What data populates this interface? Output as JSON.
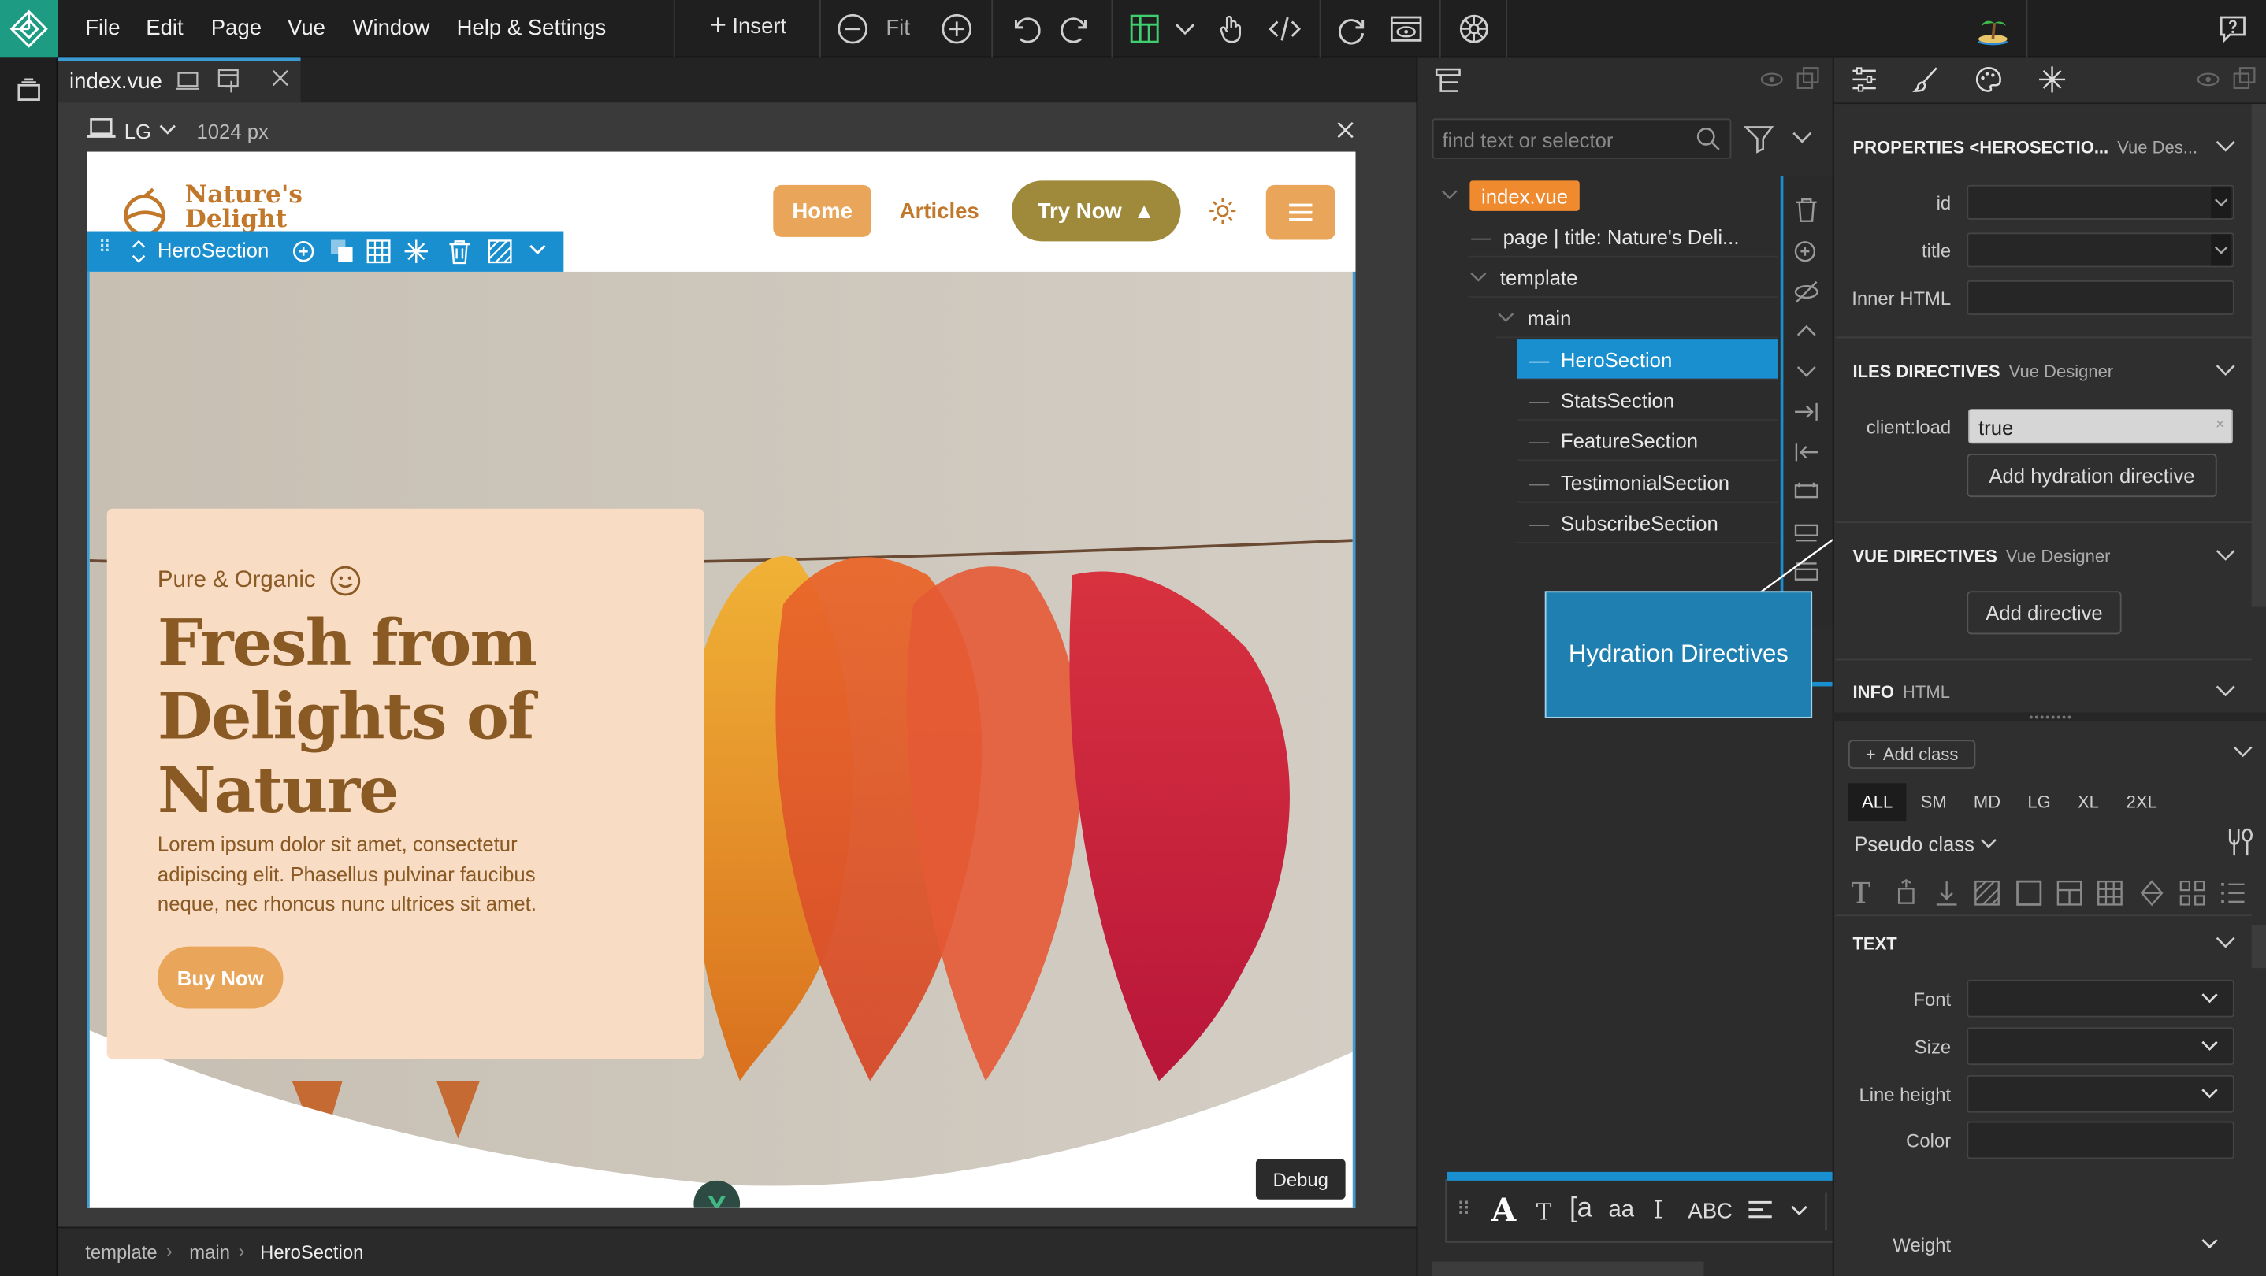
{
  "menu": [
    "File",
    "Edit",
    "Page",
    "Vue",
    "Window",
    "Help & Settings"
  ],
  "toolbar": {
    "insert": "Insert",
    "fit": "Fit"
  },
  "tab": {
    "name": "index.vue"
  },
  "device": {
    "size": "LG",
    "width": "1024 px"
  },
  "site": {
    "brand_line1": "Nature's",
    "brand_line2": "Delight",
    "nav": {
      "home": "Home",
      "articles": "Articles",
      "try": "Try Now"
    },
    "eyebrow": "Pure & Organic",
    "title_line1": "Fresh from",
    "title_line2": "Delights of",
    "title_line3": "Nature",
    "body": "Lorem ipsum dolor sit amet, consectetur adipiscing elit. Phasellus pulvinar faucibus neque, nec rhoncus nunc ultrices sit amet.",
    "cta": "Buy Now",
    "debug": "Debug"
  },
  "selection": {
    "label": "HeroSection"
  },
  "breadcrumb": [
    "template",
    "main",
    "HeroSection"
  ],
  "tree": {
    "search_placeholder": "find text or selector",
    "root": "index.vue",
    "items": [
      {
        "label": "page | title: Nature's Deli..."
      },
      {
        "label": "template"
      },
      {
        "label": "main"
      },
      {
        "label": "HeroSection"
      },
      {
        "label": "StatsSection"
      },
      {
        "label": "FeatureSection"
      },
      {
        "label": "TestimonialSection"
      },
      {
        "label": "SubscribeSection"
      }
    ]
  },
  "callout": "Hydration Directives",
  "props": {
    "section_title": "PROPERTIES <HEROSECTIO...",
    "section_sub": "Vue Des...",
    "id_label": "id",
    "title_label": "title",
    "inner_label": "Inner HTML",
    "islands_title": "ILES DIRECTIVES",
    "islands_sub": "Vue Designer",
    "client_label": "client:load",
    "client_value": "true",
    "add_hydration": "Add hydration directive",
    "vue_title": "VUE DIRECTIVES",
    "vue_sub": "Vue Designer",
    "add_directive": "Add directive",
    "info_title": "INFO",
    "info_sub": "HTML",
    "add_class": "Add class",
    "breakpoints": [
      "ALL",
      "SM",
      "MD",
      "LG",
      "XL",
      "2XL"
    ],
    "pseudo": "Pseudo class",
    "text_title": "TEXT",
    "font_label": "Font",
    "size_label": "Size",
    "lineheight_label": "Line height",
    "color_label": "Color",
    "weight_label": "Weight"
  },
  "textbar": {
    "abc": "ABC"
  }
}
